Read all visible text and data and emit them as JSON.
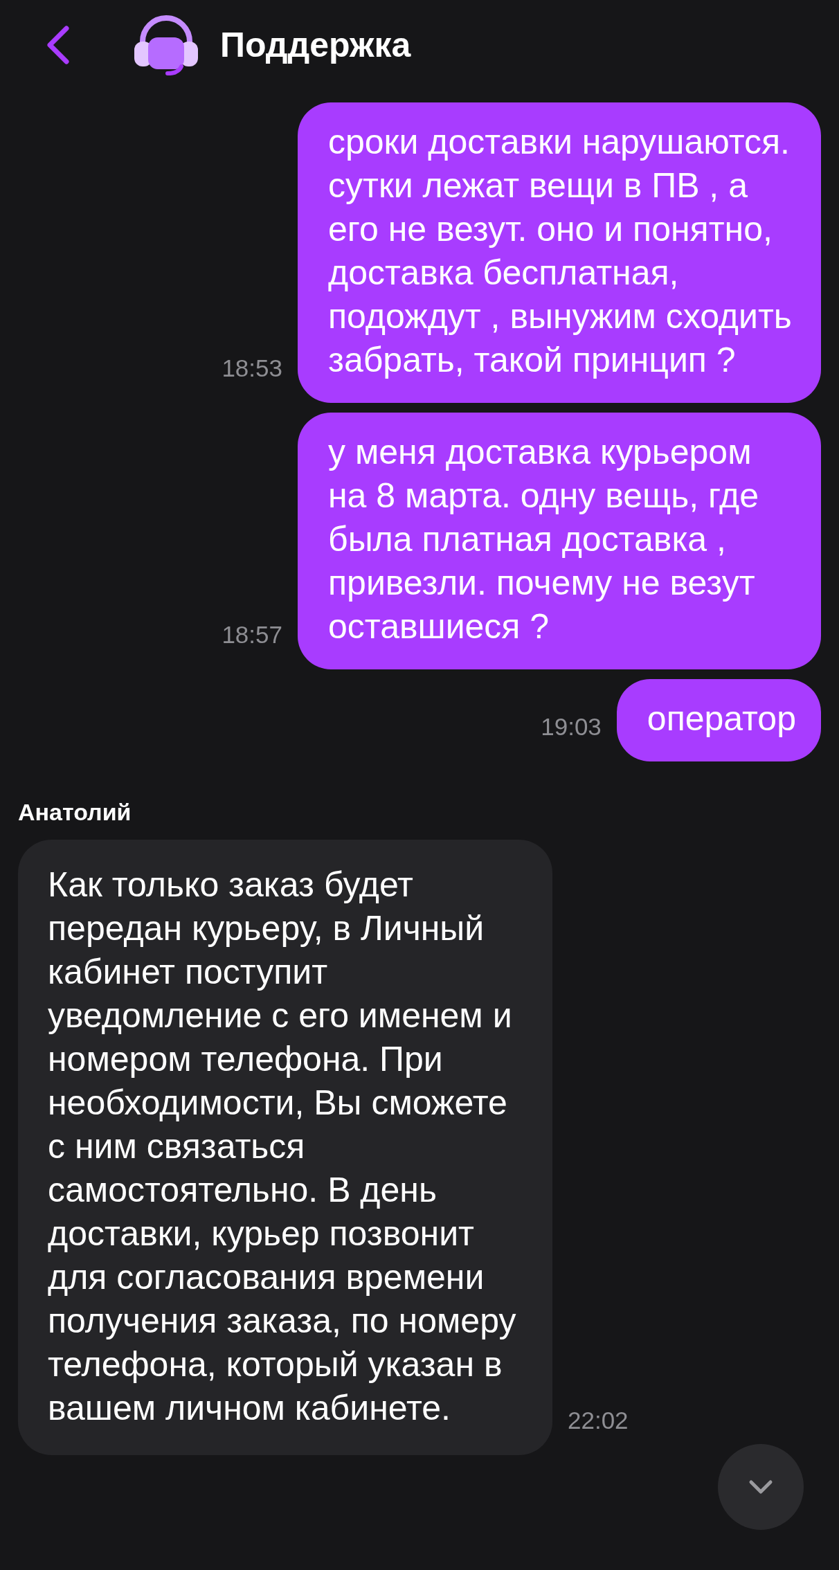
{
  "header": {
    "title": "Поддержка"
  },
  "messages": [
    {
      "kind": "outgoing",
      "text": "сроки доставки нарушаются. сутки лежат вещи в ПВ , а его не везут. оно и понятно, доставка бесплатная, подождут , вынужим сходить забрать, такой принцип ?",
      "time": "18:53"
    },
    {
      "kind": "outgoing",
      "text": "у меня доставка курьером на 8 марта. одну вещь, где была платная доставка , привезли. почему не везут оставшиеся ?",
      "time": "18:57"
    },
    {
      "kind": "outgoing",
      "text": "оператор",
      "time": "19:03"
    },
    {
      "kind": "incoming",
      "sender": "Анатолий",
      "text": "Как только заказ будет передан курьеру, в Личный кабинет поступит уведомление с его именем и номером телефона. При необходимости, Вы сможете с ним связаться самостоятельно. В день доставки, курьер позвонит для согласования времени получения заказа, по номеру телефона, который указан в вашем личном кабинете.",
      "time": "22:02"
    }
  ]
}
